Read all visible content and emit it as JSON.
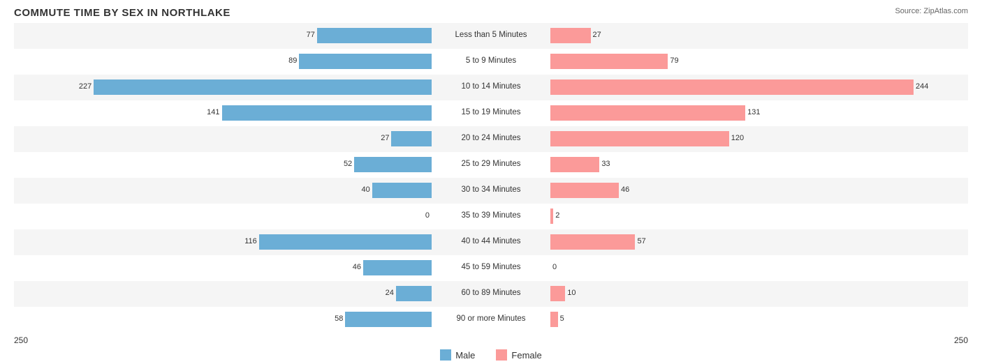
{
  "title": "COMMUTE TIME BY SEX IN NORTHLAKE",
  "source": "Source: ZipAtlas.com",
  "maxVal": 244,
  "chartWidth": 1406,
  "centerOffset": 703,
  "legend": {
    "male_label": "Male",
    "female_label": "Female",
    "male_color": "#6baed6",
    "female_color": "#fb9a99"
  },
  "axis": {
    "left": "250",
    "right": "250"
  },
  "rows": [
    {
      "label": "Less than 5 Minutes",
      "male": 77,
      "female": 27
    },
    {
      "label": "5 to 9 Minutes",
      "male": 89,
      "female": 79
    },
    {
      "label": "10 to 14 Minutes",
      "male": 227,
      "female": 244
    },
    {
      "label": "15 to 19 Minutes",
      "male": 141,
      "female": 131
    },
    {
      "label": "20 to 24 Minutes",
      "male": 27,
      "female": 120
    },
    {
      "label": "25 to 29 Minutes",
      "male": 52,
      "female": 33
    },
    {
      "label": "30 to 34 Minutes",
      "male": 40,
      "female": 46
    },
    {
      "label": "35 to 39 Minutes",
      "male": 0,
      "female": 2
    },
    {
      "label": "40 to 44 Minutes",
      "male": 116,
      "female": 57
    },
    {
      "label": "45 to 59 Minutes",
      "male": 46,
      "female": 0
    },
    {
      "label": "60 to 89 Minutes",
      "male": 24,
      "female": 10
    },
    {
      "label": "90 or more Minutes",
      "male": 58,
      "female": 5
    }
  ]
}
